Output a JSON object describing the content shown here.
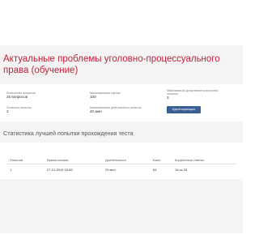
{
  "test": {
    "title": "Актуальные проблемы уголовно-процессуального права (обучение)"
  },
  "info": {
    "question_count_label": "Количество вопросов",
    "question_count_value": "25 вопросов",
    "max_score_label": "Максимальная оценка",
    "max_score_value": "100",
    "max_attempts_label": "Максимально допустимое количество попыток",
    "max_attempts_value": "3",
    "attempts_left_label": "Осталось попыток",
    "attempts_left_value": "2",
    "max_duration_label": "Максимальная длительность попытки",
    "max_duration_value": "40 мин",
    "identify_button": "Идентификация"
  },
  "stats": {
    "title": "Статистика лучшей попытки прохождения теста",
    "columns": [
      "Попытка",
      "Время начала",
      "Длительность",
      "Балл",
      "Корректные ответы"
    ],
    "rows": [
      [
        "1",
        "27-01-2019 15:56",
        "29 мин",
        "84",
        "16 из 25"
      ]
    ]
  },
  "colors": {
    "accent": "#c21f3a",
    "button": "#3a5f95",
    "card_background": "#f4f4f4"
  }
}
